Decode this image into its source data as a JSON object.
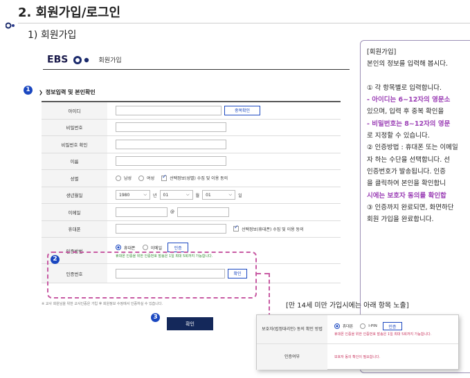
{
  "heading": "2. 회원가입/로그인",
  "subheading": "1) 회원가입",
  "form": {
    "logo_text": "EBS",
    "logo_title": "회원가입",
    "badge_1": "1",
    "section_title": "정보입력 및 본인확인",
    "fields": {
      "id_label": "아이디",
      "id_check_button": "중복확인",
      "password_label": "비밀번호",
      "password_confirm_label": "비밀번호 확인",
      "name_label": "이름",
      "gender_label": "성별",
      "gender_male": "남성",
      "gender_female": "여성",
      "gender_consent": "선택정보(성별) 수집 및 이용 동의",
      "birth_label": "생년월일",
      "birth_year": "1980",
      "birth_year_unit": "년",
      "birth_month": "01",
      "birth_month_unit": "월",
      "birth_day": "01",
      "birth_day_unit": "일",
      "email_label": "이메일",
      "email_at": "@",
      "phone_label": "휴대폰",
      "phone_consent": "선택정보(휴대폰) 수집 및 이용 동의",
      "auth_method_label": "인증방법",
      "auth_phone": "휴대폰",
      "auth_email": "이메일",
      "auth_button": "인증",
      "auth_note": "휴대폰 인증을 위한 인증번호 발송은 1일 최대 5회까지 가능합니다.",
      "auth_code_label": "인증번호",
      "auth_code_button": "확인"
    },
    "badge_2": "2",
    "footnote": "※ 교사 회원님을 위한 교사인증은 가입 후 회원정보 수정에서 인증하실 수 있습니다.",
    "badge_3": "3",
    "confirm_button": "확인"
  },
  "guide": {
    "lines": [
      {
        "text": "[회원가입]",
        "style": "normal"
      },
      {
        "text": "본인의 정보를 입력해 봅시다.",
        "style": "normal"
      },
      {
        "text": "",
        "style": "normal"
      },
      {
        "text": "① 각 항목별로 입력합니다.",
        "style": "normal"
      },
      {
        "text": "   - 아이디는 6~12자의 영문소",
        "style": "purple"
      },
      {
        "text": "   있으며, 입력 후 중복 확인을 ",
        "style": "normal"
      },
      {
        "text": "   - 비밀번호는 8~12자의 영문",
        "style": "purple"
      },
      {
        "text": "   로 지정할 수 있습니다.",
        "style": "normal"
      },
      {
        "text": "② 인증방법 : 휴대폰 또는 이메일",
        "style": "normal"
      },
      {
        "text": "   자 하는 수단을 선택합니다. 선",
        "style": "normal"
      },
      {
        "text": "   인증번호가 발송됩니다. 인증",
        "style": "normal"
      },
      {
        "text": "   을 클릭하여 본인을 확인합니",
        "style": "normal"
      },
      {
        "text": "   시에는 보호자 동의를 확인합",
        "style": "purple"
      },
      {
        "text": "③ 인증까지 완료되면, 화면하단",
        "style": "normal"
      },
      {
        "text": "   회원 가입을 완료합니다.",
        "style": "normal"
      }
    ]
  },
  "under14": {
    "title": "[만 14세 미만 가입시에는 아래 항목 노출]",
    "guardian_label": "보호자(법정대리인) 동의 확인 방법",
    "auth_phone": "휴대폰",
    "auth_ipin": "I-PIN",
    "auth_button": "인증",
    "auth_note": "휴대폰 인증을 위한 인증번호 발송은 1일 최대 5회까지 가능합니다.",
    "auth_status_label": "인증여부",
    "auth_status_value": "보호자 동의 확인이 필요합니다."
  }
}
